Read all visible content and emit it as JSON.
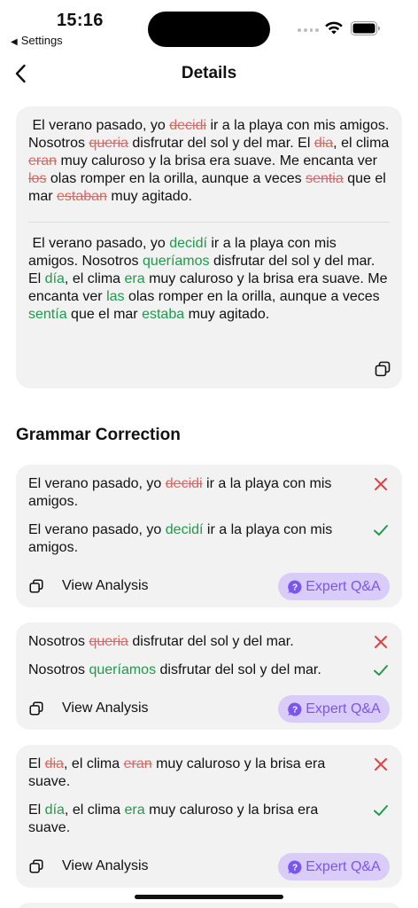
{
  "status_bar": {
    "time": "15:16",
    "back_app": "Settings"
  },
  "nav": {
    "title": "Details"
  },
  "essay": {
    "original": [
      {
        "t": " El verano pasado, yo "
      },
      {
        "t": "decidi",
        "k": "del"
      },
      {
        "t": " ir a la playa con mis amigos. Nosotros "
      },
      {
        "t": "queria",
        "k": "del"
      },
      {
        "t": " disfrutar del sol y del mar. El "
      },
      {
        "t": "dia",
        "k": "del"
      },
      {
        "t": ", el clima "
      },
      {
        "t": "eran",
        "k": "del"
      },
      {
        "t": " muy caluroso y la brisa era suave. Me encanta ver "
      },
      {
        "t": "los",
        "k": "del"
      },
      {
        "t": " olas romper en la orilla, aunque a veces "
      },
      {
        "t": "sentia",
        "k": "del"
      },
      {
        "t": " que el mar "
      },
      {
        "t": "estaban",
        "k": "del"
      },
      {
        "t": " muy agitado."
      }
    ],
    "corrected": [
      {
        "t": " El verano pasado, yo "
      },
      {
        "t": "decidí",
        "k": "ins"
      },
      {
        "t": " ir a la playa con mis amigos. Nosotros "
      },
      {
        "t": "queríamos",
        "k": "ins"
      },
      {
        "t": " disfrutar del sol y del mar. El "
      },
      {
        "t": "día",
        "k": "ins"
      },
      {
        "t": ", el clima "
      },
      {
        "t": "era",
        "k": "ins"
      },
      {
        "t": " muy caluroso y la brisa era suave. Me encanta ver "
      },
      {
        "t": "las",
        "k": "ins"
      },
      {
        "t": " olas romper en la orilla, aunque a veces "
      },
      {
        "t": "sentía",
        "k": "ins"
      },
      {
        "t": " que el mar "
      },
      {
        "t": "estaba",
        "k": "ins"
      },
      {
        "t": " muy agitado."
      }
    ]
  },
  "grammar": {
    "section_title": "Grammar Correction",
    "view_analysis": "View Analysis",
    "expert_label": "Expert Q&A",
    "items": [
      {
        "wrong": [
          {
            "t": "El verano pasado, yo "
          },
          {
            "t": "decidi",
            "k": "del"
          },
          {
            "t": " ir a la playa con mis amigos."
          }
        ],
        "right": [
          {
            "t": "El verano pasado, yo "
          },
          {
            "t": "decidí",
            "k": "ins"
          },
          {
            "t": " ir a la playa con mis amigos."
          }
        ]
      },
      {
        "wrong": [
          {
            "t": "Nosotros "
          },
          {
            "t": "queria",
            "k": "del"
          },
          {
            "t": " disfrutar del sol y del mar."
          }
        ],
        "right": [
          {
            "t": "Nosotros "
          },
          {
            "t": "queríamos",
            "k": "ins"
          },
          {
            "t": " disfrutar del sol y del mar."
          }
        ]
      },
      {
        "wrong": [
          {
            "t": "El "
          },
          {
            "t": "dia",
            "k": "del"
          },
          {
            "t": ", el clima "
          },
          {
            "t": "eran",
            "k": "del"
          },
          {
            "t": " muy caluroso y la brisa era suave."
          }
        ],
        "right": [
          {
            "t": "El "
          },
          {
            "t": "día",
            "k": "ins"
          },
          {
            "t": ", el clima "
          },
          {
            "t": "era",
            "k": "ins"
          },
          {
            "t": " muy caluroso y la brisa era suave."
          }
        ]
      }
    ]
  },
  "colors": {
    "deleted": "#e8615f",
    "inserted": "#1f9a4a",
    "expert_bg": "#d9ccf8",
    "expert_fg": "#7a55ee"
  }
}
